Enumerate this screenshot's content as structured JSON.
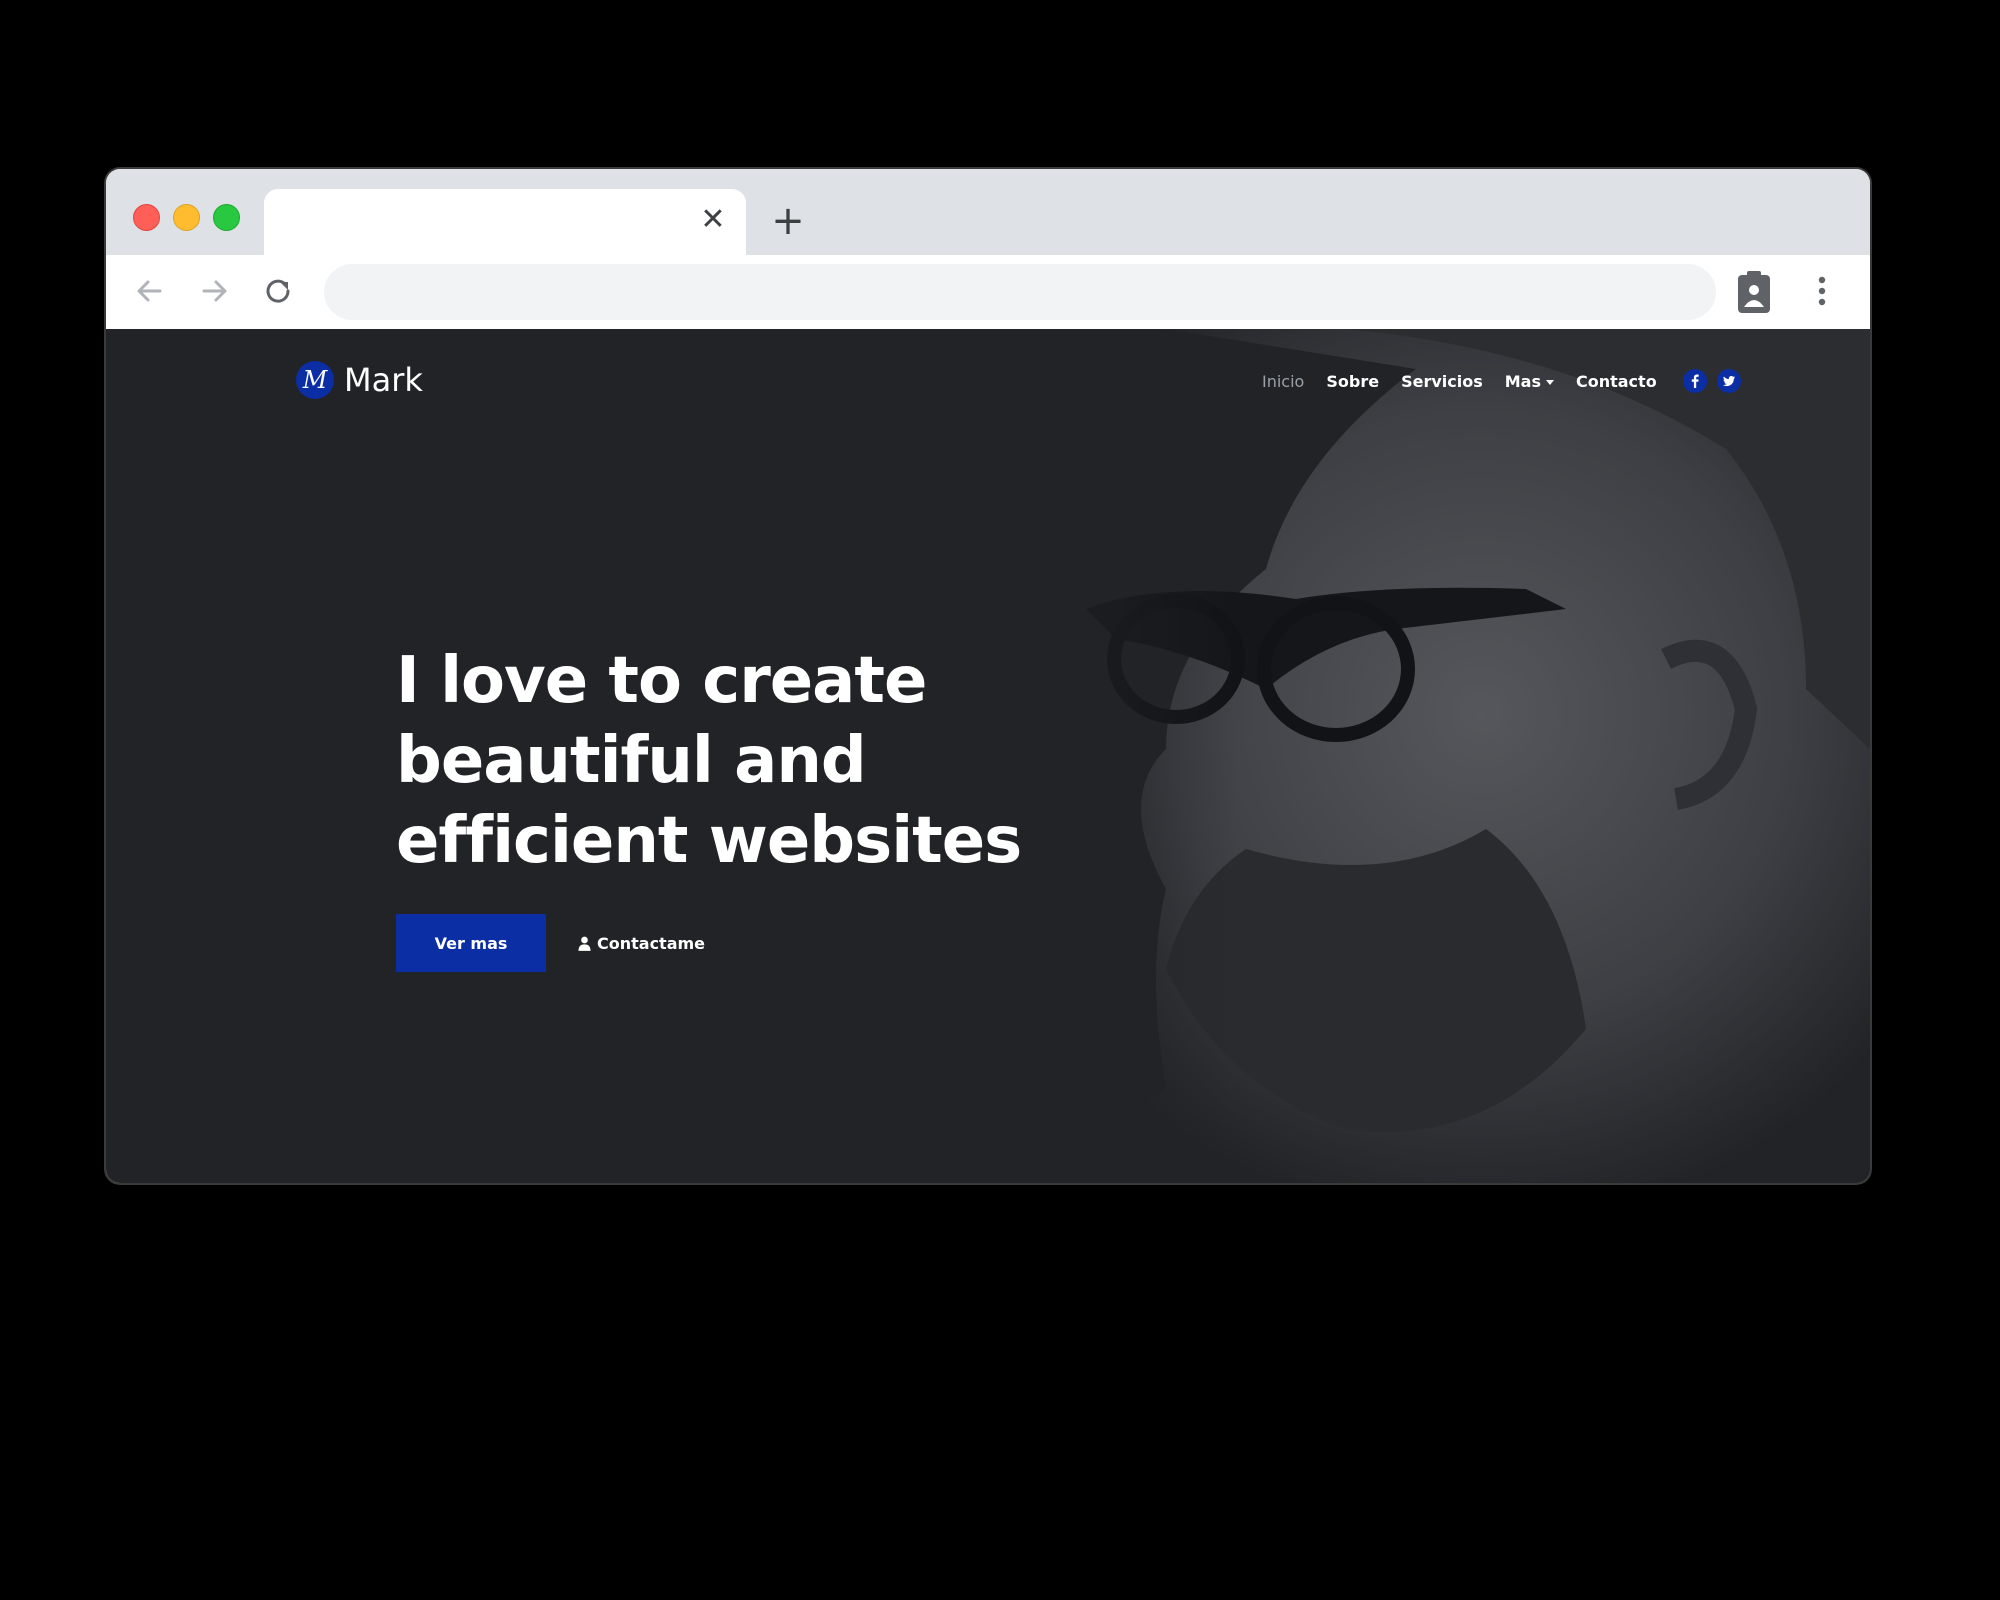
{
  "browser": {
    "tab_close": "✕",
    "new_tab": "+",
    "address": ""
  },
  "site": {
    "brand": {
      "logo_letter": "M",
      "name": "Mark"
    },
    "nav": [
      {
        "label": "Inicio",
        "active": true
      },
      {
        "label": "Sobre"
      },
      {
        "label": "Servicios"
      },
      {
        "label": "Mas",
        "dropdown": true
      },
      {
        "label": "Contacto"
      }
    ],
    "social": [
      "facebook-icon",
      "twitter-icon"
    ],
    "hero": {
      "title_lines": [
        "I love to create",
        "beautiful and",
        "efficient websites"
      ],
      "primary_button": "Ver mas",
      "secondary_button": "Contactame"
    }
  },
  "colors": {
    "accent": "#0b2ea4",
    "background": "#222327",
    "inactive_nav": "#9aa0a8"
  }
}
